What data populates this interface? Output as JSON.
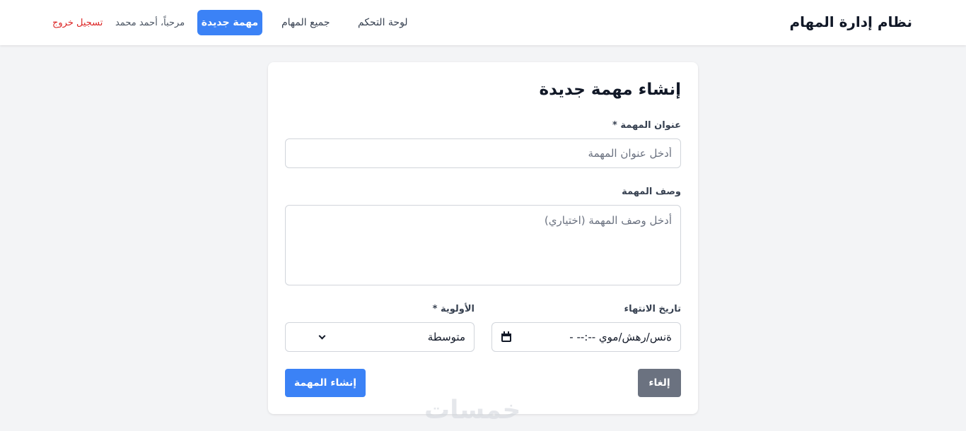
{
  "navbar": {
    "brand": "نظام إدارة المهام",
    "links": {
      "dashboard": "لوحة التحكم",
      "all_tasks": "جميع المهام",
      "new_task": "مهمة جديدة"
    },
    "welcome": "مرحباً، أحمد محمد",
    "logout": "تسجيل خروج"
  },
  "form": {
    "title": "إنشاء مهمة جديدة",
    "task_title": {
      "label": "عنوان المهمة *",
      "placeholder": "أدخل عنوان المهمة",
      "value": ""
    },
    "description": {
      "label": "وصف المهمة",
      "placeholder": "أدخل وصف المهمة (اختياري)",
      "value": ""
    },
    "due_date": {
      "label": "تاريخ الانتهاء",
      "display": "ةنس/رهش/موي  --:-- -"
    },
    "priority": {
      "label": "الأولوية *",
      "selected": "متوسطة"
    },
    "buttons": {
      "create": "إنشاء المهمة",
      "cancel": "إلغاء"
    }
  },
  "watermark": "خمسات",
  "colors": {
    "primary": "#3b82f6",
    "secondary": "#6b7280",
    "danger": "#dc2626",
    "background": "#f3f4f6"
  }
}
